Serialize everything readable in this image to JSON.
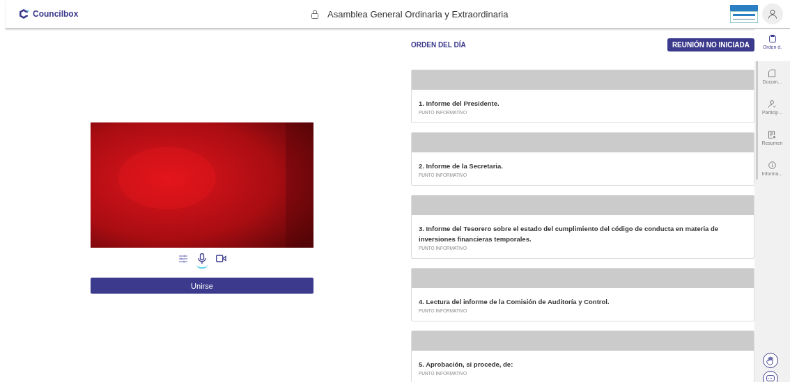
{
  "header": {
    "brand": "Councilbox",
    "title": "Asamblea General Ordinaria y Extraordinaria"
  },
  "media_controls": [
    {
      "kind": "settings",
      "selected": false
    },
    {
      "kind": "mic",
      "selected": true
    },
    {
      "kind": "camera",
      "selected": false
    }
  ],
  "join_button": "Unirse",
  "agenda": {
    "title": "ORDEN DEL DÍA",
    "status": "REUNIÓN NO INICIADA",
    "items": [
      {
        "title": "1. Informe del Presidente.",
        "type": "PUNTO INFORMATIVO"
      },
      {
        "title": "2. Informe de la Secretaria.",
        "type": "PUNTO INFORMATIVO"
      },
      {
        "title": "3. Informe del Tesorero sobre el estado del cumplimiento del código de conducta en materia de inversiones financieras temporales.",
        "type": "PUNTO INFORMATIVO"
      },
      {
        "title": "4. Lectura del informe de la Comisión de Auditoría y Control.",
        "type": "PUNTO INFORMATIVO"
      },
      {
        "title": "5. Aprobación, si procede, de:",
        "type": "PUNTO INFORMATIVO"
      }
    ]
  },
  "side_tabs": [
    {
      "kind": "agenda",
      "label": "Orden d.",
      "selected": true
    },
    {
      "kind": "documents",
      "label": "Docum...",
      "selected": false
    },
    {
      "kind": "participants",
      "label": "Particip...",
      "selected": false
    },
    {
      "kind": "summary",
      "label": "Resumen",
      "selected": false
    },
    {
      "kind": "info",
      "label": "Informa...",
      "selected": false
    }
  ]
}
